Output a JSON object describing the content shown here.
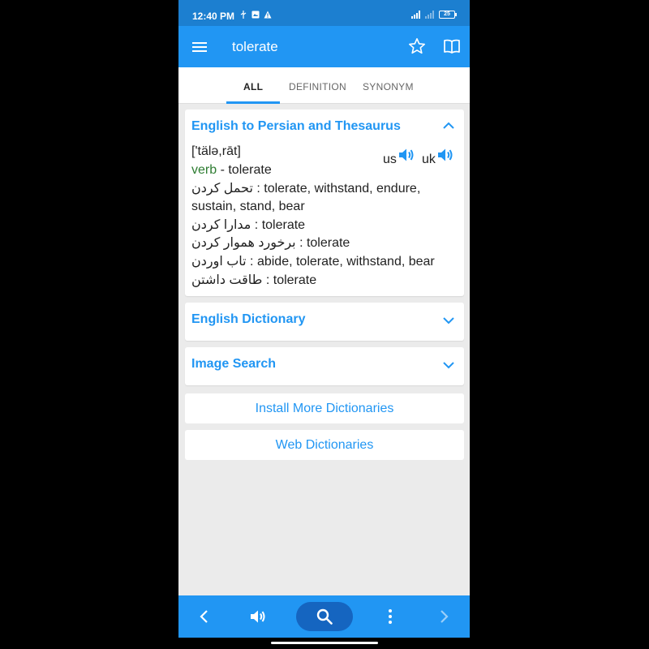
{
  "status_bar": {
    "time": "12:40 PM",
    "battery": "25"
  },
  "app_bar": {
    "query": "tolerate",
    "icons": [
      "menu-icon",
      "star-icon",
      "book-icon"
    ]
  },
  "tabs": [
    {
      "label": "ALL",
      "active": true
    },
    {
      "label": "DEFINITION",
      "active": false
    },
    {
      "label": "SYNONYM",
      "active": false
    }
  ],
  "cards": {
    "persian": {
      "title": "English to Persian and Thesaurus",
      "pronunciation": "['tälə,rāt]",
      "us_label": "us",
      "uk_label": "uk",
      "pos": "verb",
      "pos_rest": " - tolerate",
      "lines": [
        {
          "fa": "تحمل کردن",
          "en": " : tolerate, withstand, endure,"
        },
        {
          "fa": "",
          "en": "sustain, stand, bear"
        },
        {
          "fa": "مدارا کردن",
          "en": " : tolerate"
        },
        {
          "fa": "برخورد هموار کردن",
          "en": " : tolerate"
        },
        {
          "fa": "تاب اوردن",
          "en": " : abide, tolerate, withstand, bear"
        },
        {
          "fa": "طاقت داشتن",
          "en": " : tolerate"
        }
      ]
    },
    "english": {
      "title": "English Dictionary"
    },
    "image": {
      "title": "Image Search"
    }
  },
  "buttons": {
    "install": "Install More Dictionaries",
    "web": "Web Dictionaries"
  },
  "colors": {
    "primary": "#2196f3",
    "status": "#1c7fd0",
    "accent_dark": "#1565c0",
    "pos_green": "#2e7d32"
  }
}
